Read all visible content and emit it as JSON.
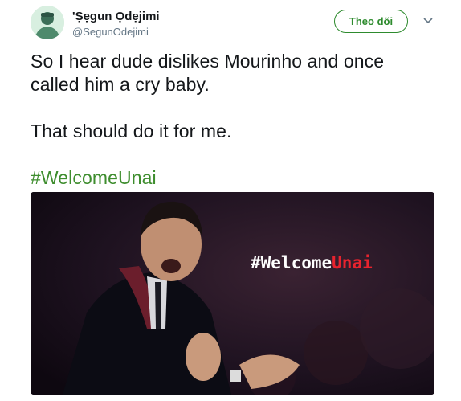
{
  "user": {
    "display_name": "'Ṣẹgun Ọdẹjimi",
    "handle": "@SegunOdejimi"
  },
  "follow_button": {
    "label": "Theo dõi"
  },
  "tweet": {
    "lines": [
      "So I hear dude dislikes Mourinho and once",
      "called him a cry baby.",
      "That should do it for me."
    ],
    "hashtag": "#WelcomeUnai"
  },
  "media": {
    "overlay_part1": "#Welcome",
    "overlay_part2": "Unai"
  },
  "colors": {
    "accent_green": "#3e8d2e",
    "overlay_red": "#e8232e"
  },
  "icons": {
    "more": "chevron-down-icon"
  }
}
